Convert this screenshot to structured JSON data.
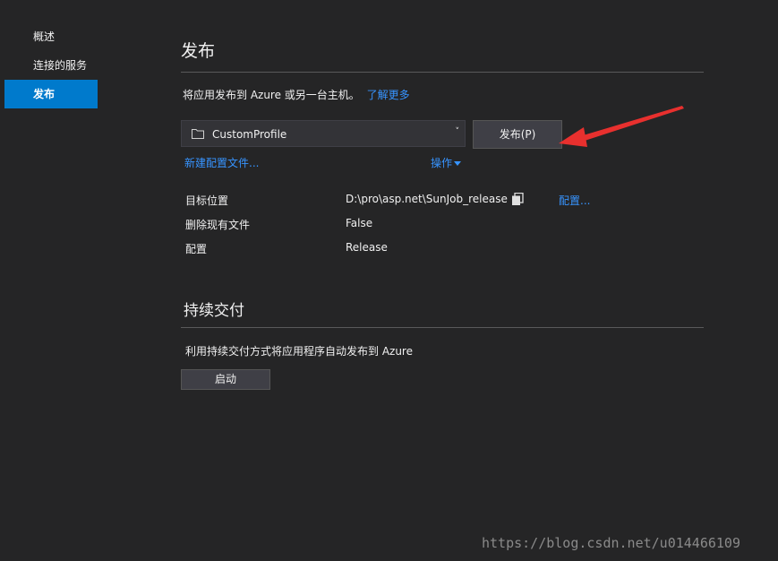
{
  "sidebar": {
    "items": [
      {
        "label": "概述"
      },
      {
        "label": "连接的服务"
      },
      {
        "label": "发布"
      }
    ]
  },
  "publish": {
    "title": "发布",
    "description": "将应用发布到 Azure 或另一台主机。",
    "learn_more": "了解更多",
    "profile_value": "CustomProfile",
    "publish_button": "发布(P)",
    "new_profile_link": "新建配置文件...",
    "actions_link": "操作",
    "properties": [
      {
        "label": "目标位置",
        "value": "D:\\pro\\asp.net\\SunJob_release"
      },
      {
        "label": "删除现有文件",
        "value": "False"
      },
      {
        "label": "配置",
        "value": "Release"
      }
    ],
    "configure_link": "配置..."
  },
  "cd": {
    "title": "持续交付",
    "description": "利用持续交付方式将应用程序自动发布到 Azure",
    "start_button": "启动"
  },
  "watermark": "https://blog.csdn.net/u014466109",
  "colors": {
    "accent": "#007acc",
    "link": "#3794ff",
    "background": "#252526",
    "arrow": "#e8302e"
  }
}
